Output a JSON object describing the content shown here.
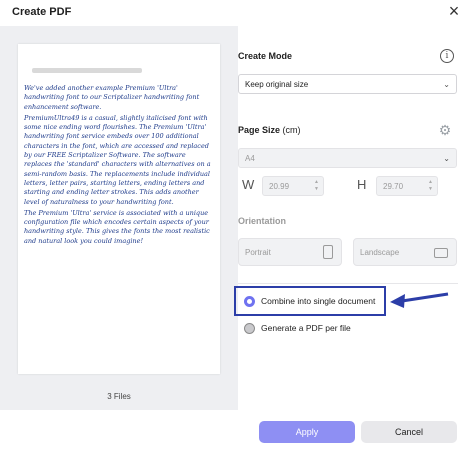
{
  "window": {
    "title": "Create PDF",
    "close_glyph": "×"
  },
  "preview": {
    "files_count": "3 Files",
    "handwriting": [
      "We've added another example Premium 'Ultra' handwriting font to our Scriptalizer handwriting font enhancement software.",
      "PremiumUltra49 is a casual, slightly italicised font with some nice ending word flourishes. The Premium 'Ultra' handwriting font service embeds over 100 additional characters in the font, which are accessed and replaced by our FREE Scriptalizer Software. The software replaces the 'standard' characters with alternatives on a semi-random basis. The replacements include individual letters, letter pairs, starting letters, ending letters and starting and ending letter strokes. This adds another level of naturalness to your handwriting font.",
      "The Premium 'Ultra' service is associated with a unique configuration file which encodes certain aspects of your handwriting style. This gives the fonts the most realistic and natural look you could imagine!"
    ]
  },
  "settings": {
    "create_mode_label": "Create Mode",
    "info_icon_glyph": "i",
    "create_mode_value": "Keep original size",
    "page_size_label": "Page Size",
    "page_size_unit": "(cm)",
    "page_size_value": "A4",
    "width_letter": "W",
    "width_value": "20.99",
    "height_letter": "H",
    "height_value": "29.70",
    "orientation_label": "Orientation",
    "portrait_label": "Portrait",
    "landscape_label": "Landscape",
    "combine_label": "Combine into single document",
    "per_file_label": "Generate a PDF per file"
  },
  "footer": {
    "apply_label": "Apply",
    "cancel_label": "Cancel"
  },
  "colors": {
    "accent": "#8e8ff3",
    "highlight": "#2c3ea8",
    "radio_on": "#6f72f0"
  },
  "icons": [
    "close-icon",
    "info-icon",
    "gear-icon",
    "chevron-down-icon",
    "portrait-icon",
    "landscape-icon",
    "arrow-pointer-icon"
  ]
}
